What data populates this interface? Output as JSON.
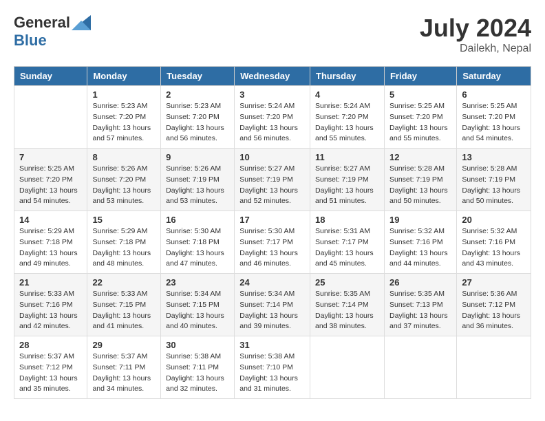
{
  "header": {
    "logo_general": "General",
    "logo_blue": "Blue",
    "month_year": "July 2024",
    "location": "Dailekh, Nepal"
  },
  "weekdays": [
    "Sunday",
    "Monday",
    "Tuesday",
    "Wednesday",
    "Thursday",
    "Friday",
    "Saturday"
  ],
  "weeks": [
    [
      {
        "day": "",
        "info": ""
      },
      {
        "day": "1",
        "info": "Sunrise: 5:23 AM\nSunset: 7:20 PM\nDaylight: 13 hours\nand 57 minutes."
      },
      {
        "day": "2",
        "info": "Sunrise: 5:23 AM\nSunset: 7:20 PM\nDaylight: 13 hours\nand 56 minutes."
      },
      {
        "day": "3",
        "info": "Sunrise: 5:24 AM\nSunset: 7:20 PM\nDaylight: 13 hours\nand 56 minutes."
      },
      {
        "day": "4",
        "info": "Sunrise: 5:24 AM\nSunset: 7:20 PM\nDaylight: 13 hours\nand 55 minutes."
      },
      {
        "day": "5",
        "info": "Sunrise: 5:25 AM\nSunset: 7:20 PM\nDaylight: 13 hours\nand 55 minutes."
      },
      {
        "day": "6",
        "info": "Sunrise: 5:25 AM\nSunset: 7:20 PM\nDaylight: 13 hours\nand 54 minutes."
      }
    ],
    [
      {
        "day": "7",
        "info": "Sunrise: 5:25 AM\nSunset: 7:20 PM\nDaylight: 13 hours\nand 54 minutes."
      },
      {
        "day": "8",
        "info": "Sunrise: 5:26 AM\nSunset: 7:20 PM\nDaylight: 13 hours\nand 53 minutes."
      },
      {
        "day": "9",
        "info": "Sunrise: 5:26 AM\nSunset: 7:19 PM\nDaylight: 13 hours\nand 53 minutes."
      },
      {
        "day": "10",
        "info": "Sunrise: 5:27 AM\nSunset: 7:19 PM\nDaylight: 13 hours\nand 52 minutes."
      },
      {
        "day": "11",
        "info": "Sunrise: 5:27 AM\nSunset: 7:19 PM\nDaylight: 13 hours\nand 51 minutes."
      },
      {
        "day": "12",
        "info": "Sunrise: 5:28 AM\nSunset: 7:19 PM\nDaylight: 13 hours\nand 50 minutes."
      },
      {
        "day": "13",
        "info": "Sunrise: 5:28 AM\nSunset: 7:19 PM\nDaylight: 13 hours\nand 50 minutes."
      }
    ],
    [
      {
        "day": "14",
        "info": "Sunrise: 5:29 AM\nSunset: 7:18 PM\nDaylight: 13 hours\nand 49 minutes."
      },
      {
        "day": "15",
        "info": "Sunrise: 5:29 AM\nSunset: 7:18 PM\nDaylight: 13 hours\nand 48 minutes."
      },
      {
        "day": "16",
        "info": "Sunrise: 5:30 AM\nSunset: 7:18 PM\nDaylight: 13 hours\nand 47 minutes."
      },
      {
        "day": "17",
        "info": "Sunrise: 5:30 AM\nSunset: 7:17 PM\nDaylight: 13 hours\nand 46 minutes."
      },
      {
        "day": "18",
        "info": "Sunrise: 5:31 AM\nSunset: 7:17 PM\nDaylight: 13 hours\nand 45 minutes."
      },
      {
        "day": "19",
        "info": "Sunrise: 5:32 AM\nSunset: 7:16 PM\nDaylight: 13 hours\nand 44 minutes."
      },
      {
        "day": "20",
        "info": "Sunrise: 5:32 AM\nSunset: 7:16 PM\nDaylight: 13 hours\nand 43 minutes."
      }
    ],
    [
      {
        "day": "21",
        "info": "Sunrise: 5:33 AM\nSunset: 7:16 PM\nDaylight: 13 hours\nand 42 minutes."
      },
      {
        "day": "22",
        "info": "Sunrise: 5:33 AM\nSunset: 7:15 PM\nDaylight: 13 hours\nand 41 minutes."
      },
      {
        "day": "23",
        "info": "Sunrise: 5:34 AM\nSunset: 7:15 PM\nDaylight: 13 hours\nand 40 minutes."
      },
      {
        "day": "24",
        "info": "Sunrise: 5:34 AM\nSunset: 7:14 PM\nDaylight: 13 hours\nand 39 minutes."
      },
      {
        "day": "25",
        "info": "Sunrise: 5:35 AM\nSunset: 7:14 PM\nDaylight: 13 hours\nand 38 minutes."
      },
      {
        "day": "26",
        "info": "Sunrise: 5:35 AM\nSunset: 7:13 PM\nDaylight: 13 hours\nand 37 minutes."
      },
      {
        "day": "27",
        "info": "Sunrise: 5:36 AM\nSunset: 7:12 PM\nDaylight: 13 hours\nand 36 minutes."
      }
    ],
    [
      {
        "day": "28",
        "info": "Sunrise: 5:37 AM\nSunset: 7:12 PM\nDaylight: 13 hours\nand 35 minutes."
      },
      {
        "day": "29",
        "info": "Sunrise: 5:37 AM\nSunset: 7:11 PM\nDaylight: 13 hours\nand 34 minutes."
      },
      {
        "day": "30",
        "info": "Sunrise: 5:38 AM\nSunset: 7:11 PM\nDaylight: 13 hours\nand 32 minutes."
      },
      {
        "day": "31",
        "info": "Sunrise: 5:38 AM\nSunset: 7:10 PM\nDaylight: 13 hours\nand 31 minutes."
      },
      {
        "day": "",
        "info": ""
      },
      {
        "day": "",
        "info": ""
      },
      {
        "day": "",
        "info": ""
      }
    ]
  ]
}
